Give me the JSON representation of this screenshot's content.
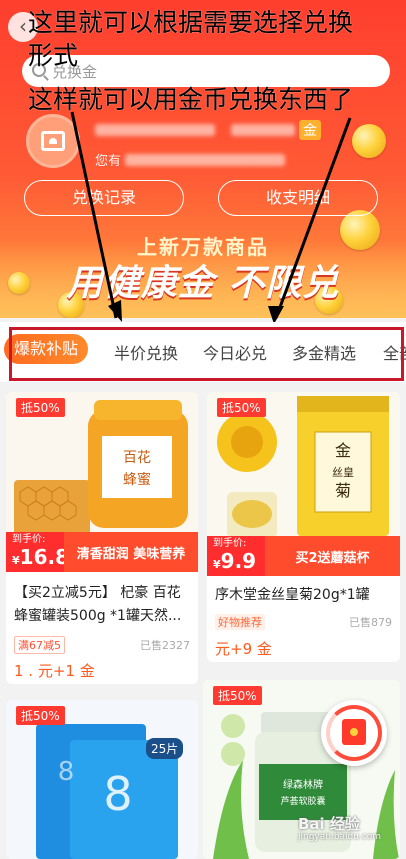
{
  "header": {
    "back_icon": "chevron-left-icon",
    "search_placeholder": "兑换金",
    "user_gold_label": "金",
    "user_line2_prefix": "您有",
    "exchange_record": "兑换记录",
    "income_detail": "收支明细",
    "banner_sub": "上新万款商品",
    "banner_main": "用健康金 不限兑"
  },
  "annotations": {
    "line1": "这里就可以根据需要选择兑换",
    "line2": "形式",
    "line3": "这样就可以用金币兑换东西了"
  },
  "tabs": [
    "爆款补贴",
    "半价兑换",
    "今日必兑",
    "多金精选",
    "全部"
  ],
  "products": [
    {
      "badge": "抵50%",
      "price_label": "到手价:",
      "price_prefix": "¥",
      "price": "16.8",
      "promo": "清香甜润  美味营养",
      "title": "【买2立减5元】 杞豪 百花蜂蜜罐装500g *1罐天然...",
      "tag": "满67减5",
      "sold": "已售2327",
      "exchange": "1  .  元+1    金"
    },
    {
      "badge": "抵50%",
      "price_label": "到手价:",
      "price_prefix": "¥",
      "price": "9.9",
      "promo": "买2送蘑菇杯",
      "title": "序木堂金丝皇菊20g*1罐",
      "tag": "好物推荐",
      "sold": "已售879",
      "exchange": "   元+9    金"
    },
    {
      "badge": "抵50%",
      "pack_label": "25片"
    },
    {
      "badge": "抵50%"
    }
  ],
  "watermark": {
    "brand": "Bai 经验",
    "url": "jingyan.baidu.com"
  },
  "colors": {
    "brand_red": "#ff3e2e",
    "accent_orange": "#ff6a1f",
    "price_red": "#ff2d2d",
    "annot_box": "#c8182a"
  }
}
